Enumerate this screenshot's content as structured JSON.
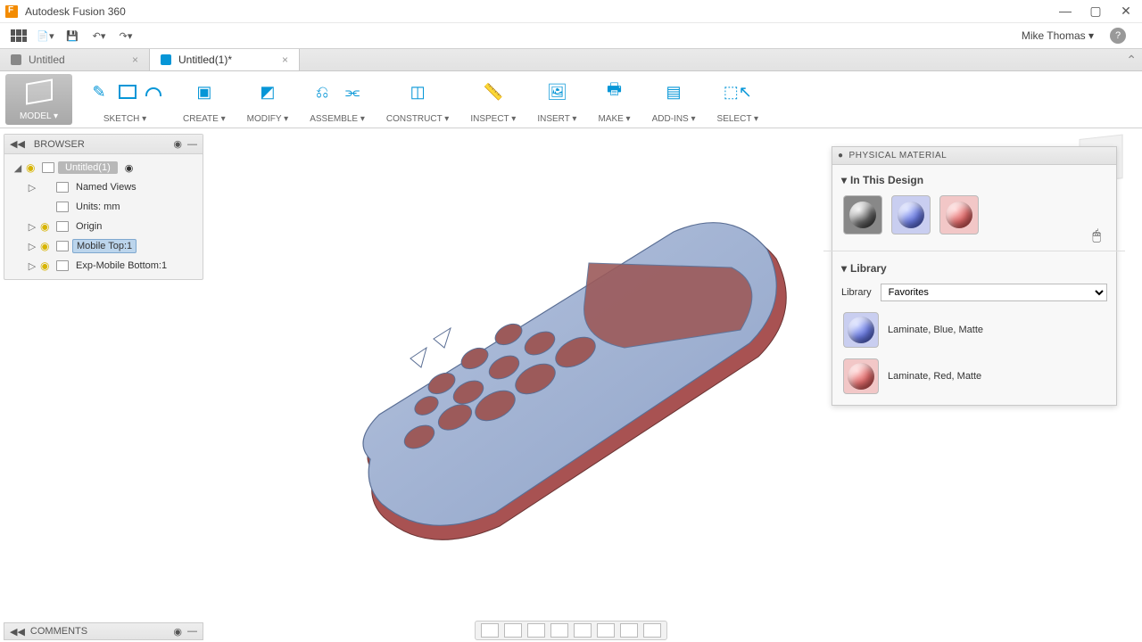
{
  "app": {
    "title": "Autodesk Fusion 360",
    "user": "Mike Thomas"
  },
  "tabs": [
    {
      "label": "Untitled",
      "active": false
    },
    {
      "label": "Untitled(1)*",
      "active": true
    }
  ],
  "ribbon": {
    "model": "MODEL",
    "groups": [
      "SKETCH",
      "CREATE",
      "MODIFY",
      "ASSEMBLE",
      "CONSTRUCT",
      "INSPECT",
      "INSERT",
      "MAKE",
      "ADD-INS",
      "SELECT"
    ]
  },
  "browser": {
    "title": "BROWSER",
    "root": "Untitled(1)",
    "nodes": [
      {
        "label": "Named Views",
        "bulb": false,
        "depth": 1,
        "sel": false
      },
      {
        "label": "Units: mm",
        "bulb": false,
        "depth": 1,
        "sel": false,
        "notw": true
      },
      {
        "label": "Origin",
        "bulb": true,
        "depth": 1,
        "sel": false
      },
      {
        "label": "Mobile Top:1",
        "bulb": true,
        "depth": 1,
        "sel": true
      },
      {
        "label": "Exp-Mobile Bottom:1",
        "bulb": true,
        "depth": 1,
        "sel": false
      }
    ]
  },
  "panel": {
    "title": "PHYSICAL MATERIAL",
    "sec1": "In This Design",
    "sec2": "Library",
    "lib_label": "Library",
    "lib_value": "Favorites",
    "materials": [
      {
        "name": "Laminate, Blue, Matte",
        "cls": "blue"
      },
      {
        "name": "Laminate, Red, Matte",
        "cls": "red"
      }
    ]
  },
  "comments": "COMMENTS"
}
